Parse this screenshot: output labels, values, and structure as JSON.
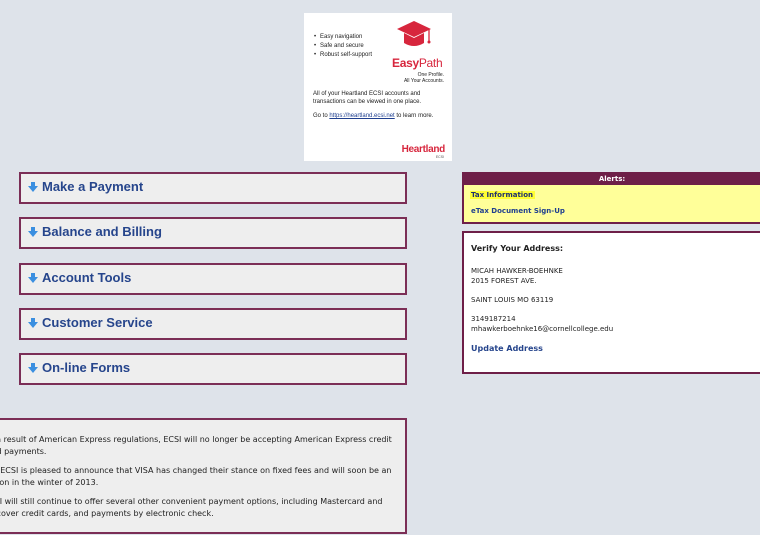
{
  "promo": {
    "bullets": [
      "Easy navigation",
      "Safe and secure",
      "Robust self-support"
    ],
    "brand_easy": "Easy",
    "brand_path": "Path",
    "tagline_line1": "One Profile.",
    "tagline_line2": "All Your Accounts.",
    "description": "All of your Heartland ECSI accounts and transactions can be viewed in one place.",
    "goto_prefix": "Go to ",
    "goto_link": "https://heartland.ecsi.net",
    "goto_suffix": " to learn more.",
    "logo_text": "Heartland",
    "logo_sub": "ECSI",
    "colors": {
      "brand_red": "#d7263d",
      "cap_red": "#d7263d"
    }
  },
  "menu": {
    "items": [
      {
        "label": "Make a Payment"
      },
      {
        "label": "Balance and Billing"
      },
      {
        "label": "Account Tools"
      },
      {
        "label": "Customer Service"
      },
      {
        "label": "On-line Forms"
      }
    ],
    "icon": "down-arrow-icon",
    "colors": {
      "border": "#7b2e56",
      "label": "#26458c",
      "arrow": "#3b8fe0"
    }
  },
  "notice": {
    "paragraphs": [
      "As a result of American Express regulations, ECSI will no longer be accepting American Express credit card payments.",
      "But ECSI is pleased to announce that VISA has changed their stance on fixed fees and will soon be an option in the winter of 2013.",
      "ECSI will still continue to offer several other convenient payment options, including Mastercard and Discover credit cards, and payments by electronic check."
    ]
  },
  "alerts": {
    "header": "Alerts:",
    "items": [
      "Tax Information",
      "eTax Document Sign-Up"
    ],
    "colors": {
      "header_bg": "#6e1f48",
      "panel_bg": "#ffff99",
      "highlight": "#ffff33"
    }
  },
  "address": {
    "title": "Verify Your Address:",
    "name": "MICAH HAWKER-BOEHNKE",
    "street": "2015 FOREST AVE.",
    "city": "SAINT LOUIS MO 63119",
    "phone": "3149187214",
    "email": "mhawkerboehnke16@cornellcollege.edu",
    "update_label": "Update Address"
  }
}
